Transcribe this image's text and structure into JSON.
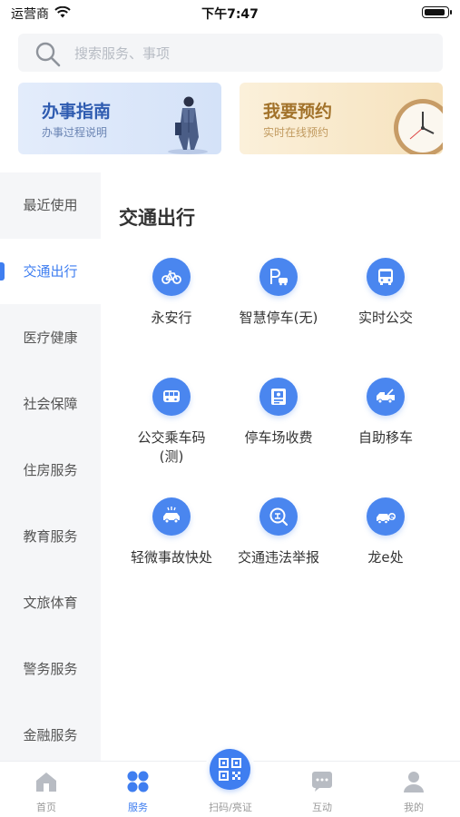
{
  "status_bar": {
    "carrier": "运营商",
    "time": "下午7:47"
  },
  "search": {
    "placeholder": "搜索服务、事项"
  },
  "banners": [
    {
      "title": "办事指南",
      "subtitle": "办事过程说明"
    },
    {
      "title": "我要预约",
      "subtitle": "实时在线预约"
    }
  ],
  "sidebar": {
    "active": "交通出行",
    "items": [
      "最近使用",
      "交通出行",
      "医疗健康",
      "社会保障",
      "住房服务",
      "教育服务",
      "文旅体育",
      "警务服务",
      "金融服务"
    ]
  },
  "section": {
    "title": "交通出行",
    "services": [
      {
        "label": "永安行",
        "icon": "bicycle-icon"
      },
      {
        "label": "智慧停车(无)",
        "icon": "parking-icon"
      },
      {
        "label": "实时公交",
        "icon": "bus-icon"
      },
      {
        "label": "公交乘车码\n(测)",
        "icon": "bus-code-icon"
      },
      {
        "label": "停车场收费",
        "icon": "parking-fee-icon"
      },
      {
        "label": "自助移车",
        "icon": "tow-truck-icon"
      },
      {
        "label": "轻微事故快处",
        "icon": "accident-icon"
      },
      {
        "label": "交通违法举报",
        "icon": "violation-report-icon"
      },
      {
        "label": "龙e处",
        "icon": "car-e-icon"
      }
    ]
  },
  "tabbar": {
    "active": "服务",
    "items": [
      {
        "label": "首页",
        "icon": "home-icon"
      },
      {
        "label": "服务",
        "icon": "services-icon"
      },
      {
        "label": "扫码/亮证",
        "icon": "qr-code-icon"
      },
      {
        "label": "互动",
        "icon": "chat-icon"
      },
      {
        "label": "我的",
        "icon": "profile-icon"
      }
    ]
  },
  "colors": {
    "accent": "#3f7ef0",
    "icon_bg": "#4a86ef",
    "sidebar_bg": "#f5f6f8"
  }
}
